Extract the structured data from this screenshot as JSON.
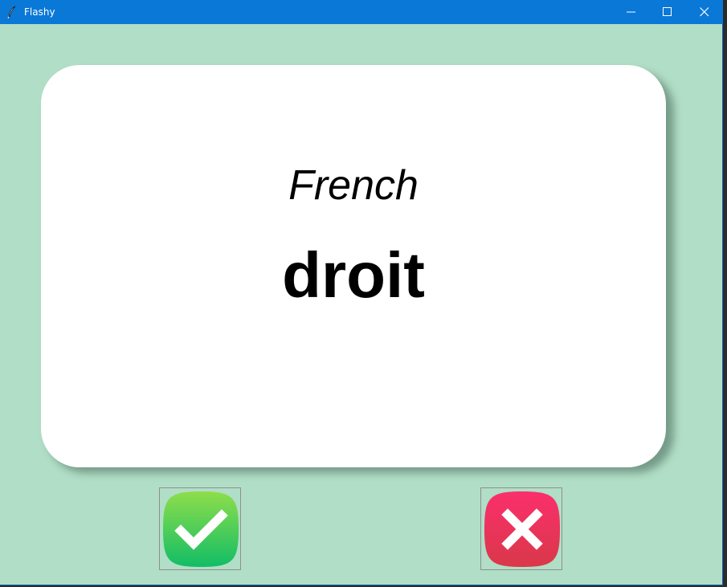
{
  "window": {
    "title": "Flashy",
    "icon": "feather-icon",
    "controls": [
      "minimize-icon",
      "maximize-icon",
      "close-icon"
    ]
  },
  "card": {
    "language": "French",
    "word": "droit"
  },
  "buttons": {
    "right": {
      "icon": "checkmark-icon",
      "color": "#1fbf5f"
    },
    "wrong": {
      "icon": "x-mark-icon",
      "color": "#e6345c"
    }
  },
  "colors": {
    "background": "#b1dec6",
    "titlebar": "#0a78d7",
    "card": "#ffffff"
  }
}
